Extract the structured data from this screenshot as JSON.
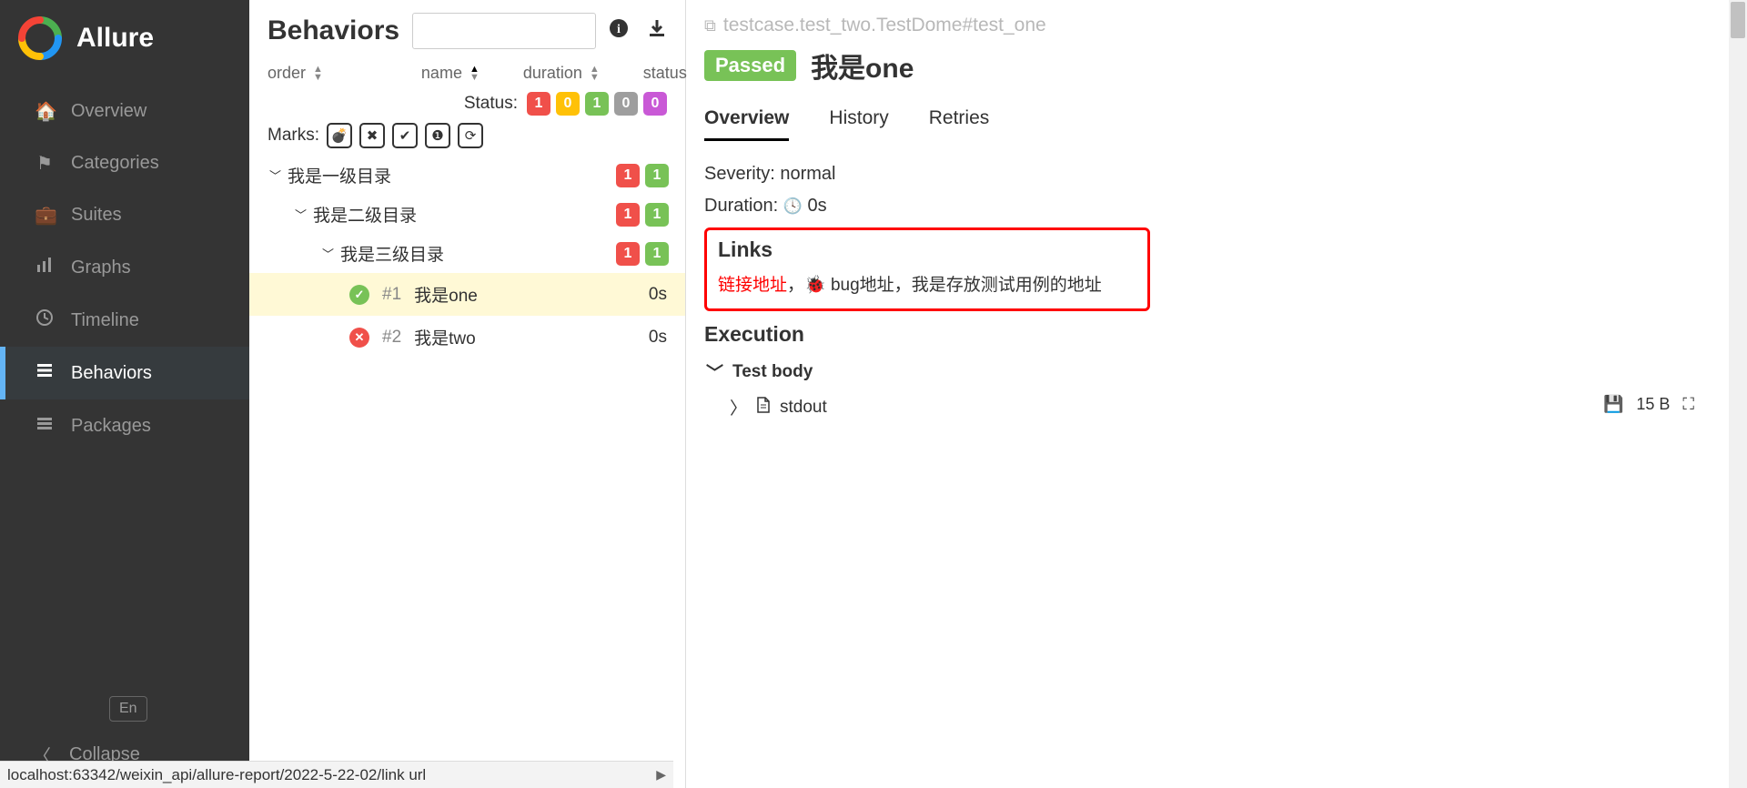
{
  "app": {
    "name": "Allure"
  },
  "sidebar": {
    "items": [
      {
        "label": "Overview"
      },
      {
        "label": "Categories"
      },
      {
        "label": "Suites"
      },
      {
        "label": "Graphs"
      },
      {
        "label": "Timeline"
      },
      {
        "label": "Behaviors"
      },
      {
        "label": "Packages"
      }
    ],
    "lang": "En",
    "collapse": "Collapse"
  },
  "middle": {
    "title": "Behaviors",
    "columns": {
      "order": "order",
      "name": "name",
      "duration": "duration",
      "status": "status"
    },
    "status_label": "Status:",
    "status_counts": {
      "failed": "1",
      "broken": "0",
      "passed": "1",
      "skipped": "0",
      "unknown": "0"
    },
    "marks_label": "Marks:",
    "tree": {
      "l1": {
        "label": "我是一级目录",
        "fail": "1",
        "pass": "1"
      },
      "l2": {
        "label": "我是二级目录",
        "fail": "1",
        "pass": "1"
      },
      "l3": {
        "label": "我是三级目录",
        "fail": "1",
        "pass": "1"
      },
      "leaf1": {
        "num": "#1",
        "label": "我是one",
        "duration": "0s"
      },
      "leaf2": {
        "num": "#2",
        "label": "我是two",
        "duration": "0s"
      }
    }
  },
  "detail": {
    "crumb": "testcase.test_two.TestDome#test_one",
    "status_tag": "Passed",
    "title": "我是one",
    "tabs": {
      "overview": "Overview",
      "history": "History",
      "retries": "Retries"
    },
    "severity_label": "Severity: ",
    "severity_value": "normal",
    "duration_label": "Duration: ",
    "duration_value": "0s",
    "links_title": "Links",
    "links": {
      "link1": "链接地址",
      "sep1": "，",
      "bug": "bug地址",
      "sep2": "，",
      "testcase": "我是存放测试用例的地址"
    },
    "execution_title": "Execution",
    "testbody_title": "Test body",
    "stdout": "stdout",
    "stdout_size": "15 B"
  },
  "statusbar": "localhost:63342/weixin_api/allure-report/2022-5-22-02/link url"
}
